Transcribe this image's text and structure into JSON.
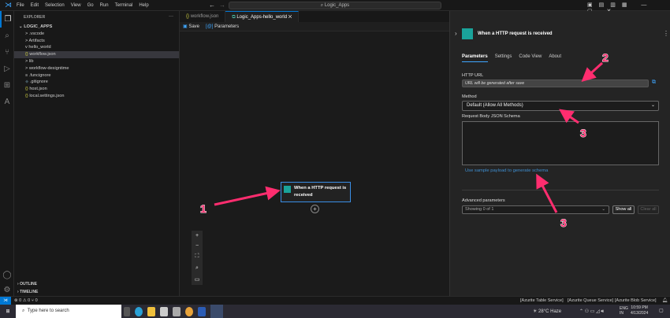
{
  "menu": [
    "File",
    "Edit",
    "Selection",
    "View",
    "Go",
    "Run",
    "Terminal",
    "Help"
  ],
  "search": "Logic_Apps",
  "explorer": {
    "title": "EXPLORER",
    "root": "LOGIC_APPS",
    "items": [
      {
        "label": ".vscode",
        "prefix": ">"
      },
      {
        "label": "Artifacts",
        "prefix": ">"
      },
      {
        "label": "hello_world",
        "prefix": "v"
      },
      {
        "label": "workflow.json",
        "prefix": "{}"
      },
      {
        "label": "lib",
        "prefix": ">"
      },
      {
        "label": "workflow-designtime",
        "prefix": ">"
      },
      {
        "label": ".funcignore",
        "prefix": "≡"
      },
      {
        "label": ".gitignore",
        "prefix": "◆"
      },
      {
        "label": "host.json",
        "prefix": "{}"
      },
      {
        "label": "local.settings.json",
        "prefix": "{}"
      }
    ],
    "outline": "OUTLINE",
    "timeline": "TIMELINE"
  },
  "tabs": [
    "workflow.json",
    "Logic_Apps-hello_world"
  ],
  "toolbar": {
    "save": "Save",
    "parameters": "Parameters"
  },
  "node": {
    "title": "When a HTTP request is received"
  },
  "panel": {
    "title": "When a HTTP request is received",
    "tabs": [
      "Parameters",
      "Settings",
      "Code View",
      "About"
    ],
    "http_url_label": "HTTP URL",
    "http_url_value": "URL will be generated after save",
    "method_label": "Method",
    "method_value": "Default (Allow All Methods)",
    "schema_label": "Request Body JSON Schema",
    "sample_link": "Use sample payload to generate schema",
    "adv_label": "Advanced parameters",
    "adv_value": "Showing 0 of 1",
    "show_all": "Show all",
    "clear_all": "Clear all"
  },
  "annotations": [
    "1",
    "2",
    "3",
    "3"
  ],
  "status": {
    "left": "⊗ 0 ⚠ 0   ⑂ 0",
    "services": [
      "[Azurite Table Service]",
      "[Azurite Queue Service]",
      "[Azurite Blob Service]"
    ]
  },
  "taskbar": {
    "search": "Type here to search",
    "weather": "28°C  Haze",
    "lang": "ENG IN",
    "time": "10:59 PM",
    "date": "4/13/2024"
  }
}
